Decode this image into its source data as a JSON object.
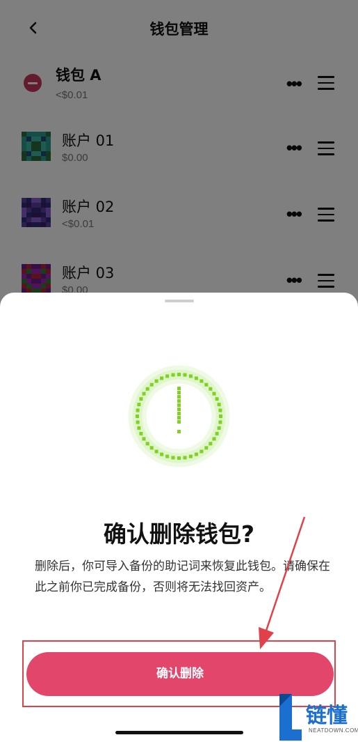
{
  "header": {
    "back_icon": "chevron-left-icon",
    "title": "钱包管理"
  },
  "wallet": {
    "name": "钱包 A",
    "balance": "<$0.01"
  },
  "accounts": [
    {
      "name": "账户 01",
      "balance": "$0.00"
    },
    {
      "name": "账户 02",
      "balance": "<$0.01"
    },
    {
      "name": "账户 03",
      "balance": "$0.00"
    }
  ],
  "row_more_glyph": "•••",
  "sheet": {
    "title": "确认删除钱包?",
    "description": "删除后，你可导入备份的助记词来恢复此钱包。请确保在此之前你已完成备份，否则将无法找回资产。",
    "confirm_label": "确认删除"
  },
  "watermark": {
    "text": "链懂",
    "sub": "NEATDOWN.COM"
  },
  "colors": {
    "accent": "#e2476b",
    "delete_badge": "#c4385a",
    "warning_green": "#7ed321",
    "annotation_red": "#e0404a"
  }
}
